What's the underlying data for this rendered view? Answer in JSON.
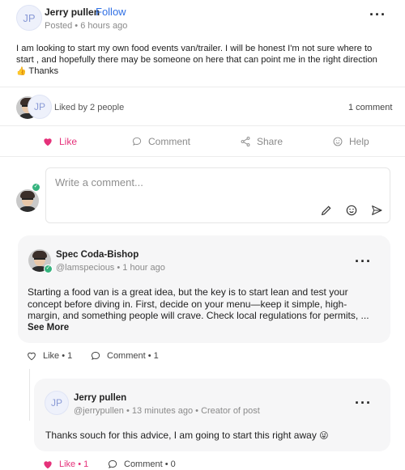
{
  "post": {
    "author_initials": "JP",
    "author_name": "Jerry pullen",
    "follow_label": "Follow",
    "meta": "Posted • 6 hours ago",
    "body_line1": "I am looking to start my own food events van/trailer. I will be honest I'm not sure where to",
    "body_line2": "start , and hopefully there may be someone on here that can point me in the right direction",
    "body_emoji": "👍",
    "body_line3": "Thanks",
    "liked_by": "Liked by 2 people",
    "comment_count": "1 comment",
    "liker_initials": "JP"
  },
  "actions": {
    "like": "Like",
    "comment": "Comment",
    "share": "Share",
    "help": "Help"
  },
  "composer": {
    "placeholder": "Write a comment..."
  },
  "comment": {
    "author_name": "Spec Coda-Bishop",
    "handle": "@lamspecious",
    "time": "1 hour ago",
    "text_line1": "Starting a food van is a great idea, but the key is to start lean and test your",
    "text_line2": "concept before diving in. First, decide on your menu—keep it simple, high-",
    "text_line3": "margin, and something people will crave. Check local regulations for permits, ...",
    "see_more": "See More",
    "like_label": "Like • 1",
    "comment_label": "Comment • 1"
  },
  "reply": {
    "author_initials": "JP",
    "author_name": "Jerry pullen",
    "handle": "@jerrypullen",
    "time": "13 minutes ago",
    "role": "Creator of post",
    "text": "Thanks souch for this advice, I am going to start this right away",
    "emoji": "😜",
    "like_label": "Like • 1",
    "comment_label": "Comment • 0"
  },
  "colors": {
    "accent_blue": "#2f6fe4",
    "like_pink": "#e5317a",
    "verified_green": "#35b37e"
  }
}
